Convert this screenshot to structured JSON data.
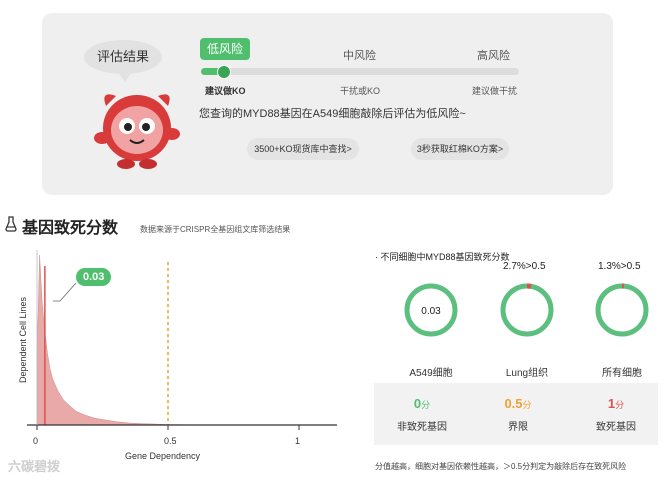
{
  "risk": {
    "bubble_text": "评估结果",
    "levels": [
      "低风险",
      "中风险",
      "高风险"
    ],
    "advice": [
      "建议做KO",
      "干扰或KO",
      "建议做干扰"
    ],
    "progress_percent": 7,
    "summary": "您查询的MYD88基因在A549细胞敲除后评估为低风险~",
    "buttons": [
      "3500+KO现货库中查找>",
      "3秒获取红棉KO方案>"
    ]
  },
  "section": {
    "title": "基因致死分数",
    "subtitle": "数据来源于CRISPR全基因组文库筛选结果"
  },
  "chart_data": {
    "type": "area",
    "xlabel": "Gene Dependency",
    "ylabel": "Dependent Cell Lines",
    "x_ticks": [
      "0",
      "0.5",
      "1"
    ],
    "xlim": [
      0,
      1.1
    ],
    "marker": {
      "x": 0.03,
      "label": "0.03",
      "color": "#d9534f"
    },
    "threshold": {
      "x": 0.5,
      "color": "#f0a030"
    },
    "x": [
      0.0,
      0.01,
      0.02,
      0.03,
      0.04,
      0.05,
      0.06,
      0.08,
      0.1,
      0.12,
      0.15,
      0.18,
      0.22,
      0.26,
      0.3,
      0.35,
      0.4,
      0.5,
      0.6
    ],
    "y": [
      40,
      100,
      72,
      55,
      42,
      33,
      27,
      20,
      15,
      12,
      8,
      6,
      4,
      3,
      2,
      1.2,
      0.8,
      0.3,
      0.1
    ]
  },
  "cells": {
    "title": "· 不同细胞中MYD88基因致死分数",
    "items": [
      {
        "pct": "",
        "center": "0.03",
        "name": "A549细胞",
        "frac": 0.0
      },
      {
        "pct": "2.7%>0.5",
        "center": "",
        "name": "Lung组织",
        "frac": 0.027
      },
      {
        "pct": "1.3%>0.5",
        "center": "",
        "name": "所有细胞",
        "frac": 0.013
      }
    ],
    "ring_color": "#5cbf7f",
    "mark_color": "#d9534f"
  },
  "legend": [
    {
      "value": "0",
      "unit": "分",
      "name": "非致死基因",
      "color": "#4fbf6e"
    },
    {
      "value": "0.5",
      "unit": "分",
      "name": "界限",
      "color": "#f0a030"
    },
    {
      "value": "1",
      "unit": "分",
      "name": "致死基因",
      "color": "#d9534f"
    }
  ],
  "footnote": "分值越高，细胞对基因依赖性越高，＞0.5分判定为敲除后存在致死风险",
  "watermark": "六碳碧拨"
}
